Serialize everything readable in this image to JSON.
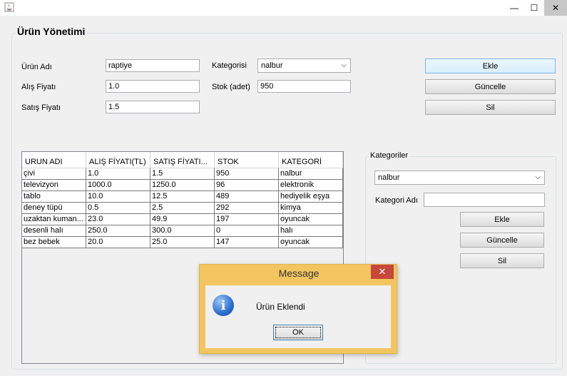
{
  "window": {
    "close_glyph": "✕",
    "minimize_glyph": "—",
    "maximize_glyph": "☐"
  },
  "panel_title": "Ürün Yönetimi",
  "form": {
    "urun_adi_label": "Ürün Adı",
    "urun_adi_value": "raptiye",
    "alis_label": "Alış Fiyatı",
    "alis_value": "1.0",
    "satis_label": "Satış Fiyatı",
    "satis_value": "1.5",
    "kategori_label": "Kategorisi",
    "kategori_value": "nalbur",
    "stok_label": "Stok (adet)",
    "stok_value": "950"
  },
  "buttons": {
    "ekle": "Ekle",
    "guncelle": "Güncelle",
    "sil": "Sil"
  },
  "table": {
    "headers": [
      "URUN ADI",
      "ALIŞ FİYATI(TL)",
      "SATIŞ FİYATI...",
      "STOK",
      "KATEGORİ"
    ],
    "rows": [
      [
        "çivi",
        "1.0",
        "1.5",
        "950",
        "nalbur"
      ],
      [
        "televizyon",
        "1000.0",
        "1250.0",
        "96",
        "elektronik"
      ],
      [
        "tablo",
        "10.0",
        "12.5",
        "489",
        "hediyelik eşya"
      ],
      [
        "deney tüpü",
        "0.5",
        "2.5",
        "292",
        "kimya"
      ],
      [
        "uzaktan kuman...",
        "23.0",
        "49.9",
        "197",
        "oyuncak"
      ],
      [
        "desenli halı",
        "250.0",
        "300.0",
        "0",
        "halı"
      ],
      [
        "bez bebek",
        "20.0",
        "25.0",
        "147",
        "oyuncak"
      ]
    ]
  },
  "categories": {
    "title": "Kategoriler",
    "selected": "nalbur",
    "name_label": "Kategori Adı",
    "name_value": "",
    "ekle": "Ekle",
    "guncelle": "Güncelle",
    "sil": "Sil"
  },
  "dialog": {
    "title": "Message",
    "message": "Ürün Eklendi",
    "ok": "OK",
    "close_glyph": "✕",
    "icon_glyph": "i"
  }
}
